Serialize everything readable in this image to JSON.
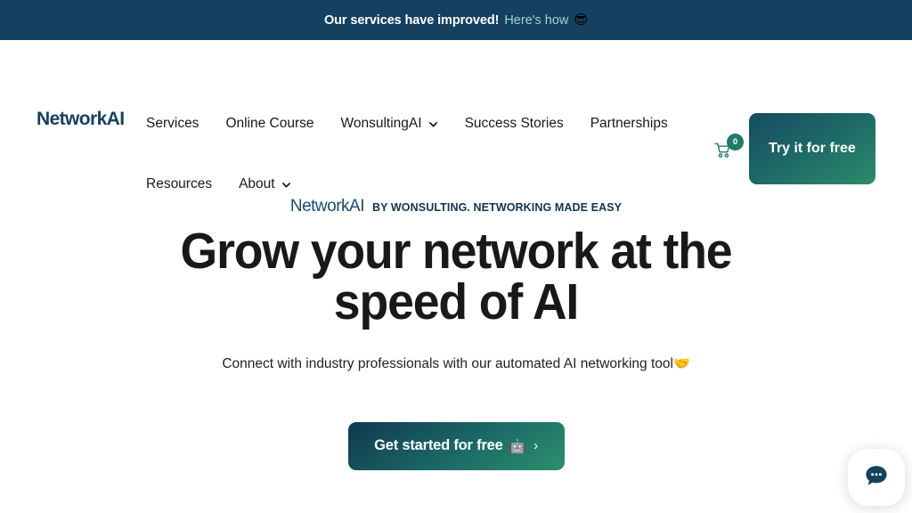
{
  "announcement": {
    "text": "Our services have improved!",
    "link_label": "Here's how",
    "emoji": "😎"
  },
  "header": {
    "logo": "NetworkAI",
    "nav_row1": [
      {
        "label": "Services",
        "has_dropdown": false
      },
      {
        "label": "Online Course",
        "has_dropdown": false
      },
      {
        "label": "WonsultingAI",
        "has_dropdown": true
      },
      {
        "label": "Success Stories",
        "has_dropdown": false
      },
      {
        "label": "Partnerships",
        "has_dropdown": false
      }
    ],
    "nav_row2": [
      {
        "label": "Resources",
        "has_dropdown": false
      },
      {
        "label": "About",
        "has_dropdown": true
      }
    ],
    "cart": {
      "icon": "shopping-cart-icon",
      "count": "0"
    },
    "cta": {
      "label": "Try it for free"
    }
  },
  "hero": {
    "eyebrow_brand": "NetworkAI",
    "eyebrow_tagline": "BY WONSULTING. NETWORKING MADE EASY",
    "headline": "Grow your network at the speed of AI",
    "subtitle": "Connect with industry professionals with our automated AI networking tool",
    "subtitle_emoji": "🤝",
    "cta_label": "Get started for free",
    "cta_emoji": "🤖",
    "cta_arrow": "›"
  },
  "chat_widget": {
    "icon": "chat-bubble-icon"
  },
  "colors": {
    "banner_bg": "#15405f",
    "banner_link": "#9fd5cf",
    "brand_navy": "#16405e",
    "accent_teal": "#1f7a6a",
    "button_gradient_start": "#174b61",
    "button_gradient_end": "#2e8b6a",
    "page_bg": "#ffffff",
    "heading_text": "#19191b"
  }
}
